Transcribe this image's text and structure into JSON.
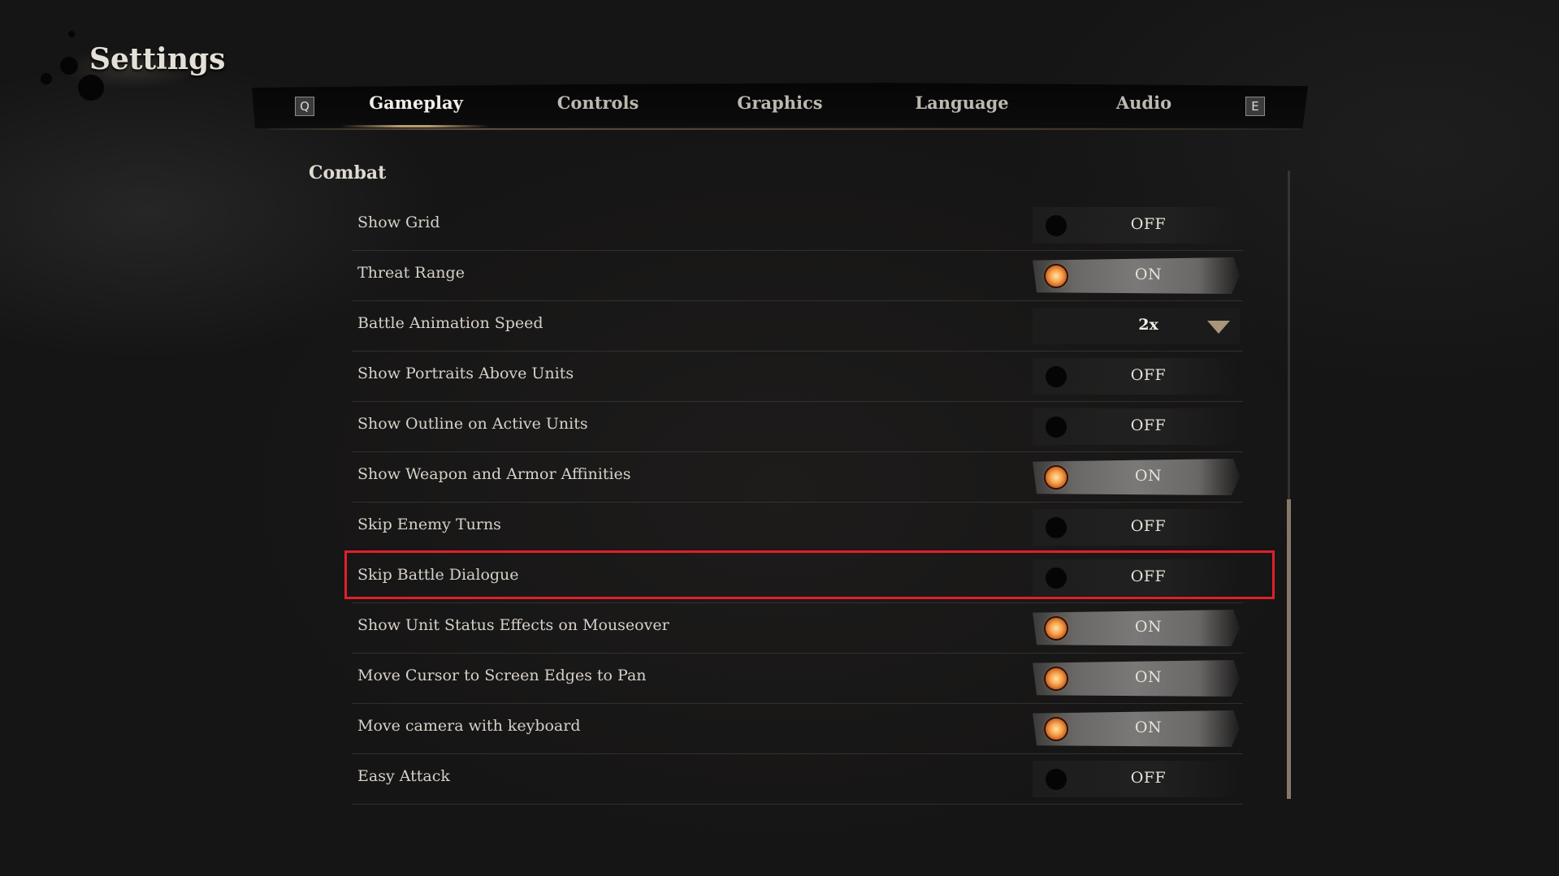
{
  "page": {
    "title": "Settings"
  },
  "tabs": {
    "prev_key": "Q",
    "next_key": "E",
    "items": [
      {
        "label": "Gameplay",
        "active": true
      },
      {
        "label": "Controls",
        "active": false
      },
      {
        "label": "Graphics",
        "active": false
      },
      {
        "label": "Language",
        "active": false
      },
      {
        "label": "Audio",
        "active": false
      }
    ]
  },
  "section": {
    "title": "Combat"
  },
  "settings": [
    {
      "label": "Show Grid",
      "type": "toggle",
      "value": "OFF"
    },
    {
      "label": "Threat Range",
      "type": "toggle",
      "value": "ON"
    },
    {
      "label": "Battle Animation Speed",
      "type": "dropdown",
      "value": "2x"
    },
    {
      "label": "Show Portraits Above Units",
      "type": "toggle",
      "value": "OFF"
    },
    {
      "label": "Show Outline on Active Units",
      "type": "toggle",
      "value": "OFF"
    },
    {
      "label": "Show Weapon and Armor Affinities",
      "type": "toggle",
      "value": "ON"
    },
    {
      "label": "Skip Enemy Turns",
      "type": "toggle",
      "value": "OFF"
    },
    {
      "label": "Skip Battle Dialogue",
      "type": "toggle",
      "value": "OFF",
      "highlighted": true
    },
    {
      "label": "Show Unit Status Effects on Mouseover",
      "type": "toggle",
      "value": "ON"
    },
    {
      "label": "Move Cursor to Screen Edges to Pan",
      "type": "toggle",
      "value": "ON"
    },
    {
      "label": "Move camera with keyboard",
      "type": "toggle",
      "value": "ON"
    },
    {
      "label": "Easy Attack",
      "type": "toggle",
      "value": "OFF"
    }
  ],
  "colors": {
    "highlight_border": "#e0202a",
    "toggle_on_knob": "#f6a34b",
    "toggle_off_knob": "#050505",
    "accent_underline": "#b89d6e"
  },
  "scroll": {
    "position_fraction": 1.0,
    "visible_fraction": 0.48
  }
}
